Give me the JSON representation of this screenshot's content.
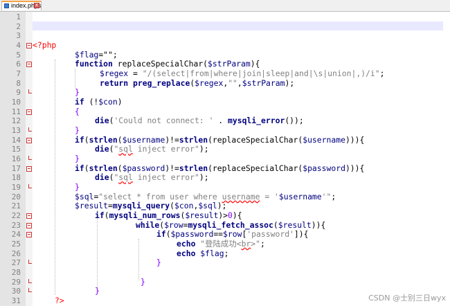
{
  "tab": {
    "filename": "index.phps",
    "icon": "save-icon",
    "close_icon": "close-icon"
  },
  "line_numbers": [
    "1",
    "2",
    "3",
    "4",
    "5",
    "6",
    "7",
    "8",
    "9",
    "10",
    "11",
    "12",
    "13",
    "14",
    "15",
    "16",
    "17",
    "18",
    "19",
    "20",
    "21",
    "22",
    "23",
    "24",
    "25",
    "26",
    "27",
    "28",
    "29",
    "30",
    "31"
  ],
  "code": {
    "l4_open": "<?php",
    "l5_flag": "$flag",
    "l5_rest": "=\"\";",
    "l6_kw": "function",
    "l6_name": " replaceSpecialChar(",
    "l6_var": "$strParam",
    "l6_end": "){",
    "l7_var": "$regex",
    "l7_eq": " = ",
    "l7_str": "\"/(select|from|where|join|sleep|and|\\s|union|,)/i\"",
    "l7_end": ";",
    "l8_kw": "return",
    "l8_fn": " preg_replace",
    "l8_a": "(",
    "l8_var1": "$regex",
    "l8_b": ",",
    "l8_str": "\"\"",
    "l8_c": ",",
    "l8_var2": "$strParam",
    "l8_d": ");",
    "l9": "}",
    "l10_kw": "if",
    "l10_a": " (!",
    "l10_var": "$con",
    "l10_b": ")",
    "l11": "{",
    "l12_kw": "die",
    "l12_a": "(",
    "l12_str": "'Could not connect: '",
    "l12_b": " . ",
    "l12_fn": "mysqli_error",
    "l12_c": "());",
    "l13": "}",
    "l14_kw": "if",
    "l14_a": "(",
    "l14_fn1": "strlen",
    "l14_b": "(",
    "l14_var1": "$username",
    "l14_c": ")!=",
    "l14_fn2": "strlen",
    "l14_d": "(replaceSpecialChar(",
    "l14_var2": "$username",
    "l14_e": "))){",
    "l15_kw": "die",
    "l15_a": "(",
    "l15_str1": "\"",
    "l15_sql": "sql",
    "l15_str2": " inject error\"",
    "l15_b": ");",
    "l16": "}",
    "l17_kw": "if",
    "l17_a": "(",
    "l17_fn1": "strlen",
    "l17_b": "(",
    "l17_var1": "$password",
    "l17_c": ")!=",
    "l17_fn2": "strlen",
    "l17_d": "(replaceSpecialChar(",
    "l17_var2": "$password",
    "l17_e": "))){",
    "l18_kw": "die",
    "l18_a": "(",
    "l18_str1": "\"",
    "l18_sql": "sql",
    "l18_str2": " inject error\"",
    "l18_b": ");",
    "l19": "}",
    "l20_var": "$sql",
    "l20_a": "=",
    "l20_str1": "\"select * from user where ",
    "l20_uname": "username",
    "l20_str2": " = '",
    "l20_var2": "$username",
    "l20_str3": "'\"",
    "l20_b": ";",
    "l21_var": "$result",
    "l21_a": "=",
    "l21_fn": "mysqli_query",
    "l21_b": "(",
    "l21_var2": "$con",
    "l21_c": ",",
    "l21_var3": "$sql",
    "l21_d": ");",
    "l22_kw": "if",
    "l22_a": "(",
    "l22_fn": "mysqli_num_rows",
    "l22_b": "(",
    "l22_var": "$result",
    "l22_c": ")>",
    "l22_num": "0",
    "l22_d": "){",
    "l23_kw": "while",
    "l23_a": "(",
    "l23_var": "$row",
    "l23_b": "=",
    "l23_fn": "mysqli_fetch_assoc",
    "l23_c": "(",
    "l23_var2": "$result",
    "l23_d": ")){",
    "l24_kw": "if",
    "l24_a": "(",
    "l24_var": "$password",
    "l24_b": "==",
    "l24_var2": "$row",
    "l24_c": "[",
    "l24_str": "'password'",
    "l24_d": "]){",
    "l25_kw": "echo",
    "l25_str1": " \"登陆成功<",
    "l25_br": "br",
    "l25_str2": ">\"",
    "l25_e": ";",
    "l26_kw": "echo",
    "l26_var": " $flag",
    "l26_e": ";",
    "l27": "}",
    "l29": "}",
    "l30": "}",
    "l31": "?>"
  },
  "watermark": "CSDN @士别三日wyx",
  "colors": {
    "variable": "#000080",
    "string": "#808080",
    "php_tag": "#ff0000",
    "operator": "#8000ff",
    "current_line": "#e8e8ff",
    "gutter": "#e4e4e4"
  }
}
